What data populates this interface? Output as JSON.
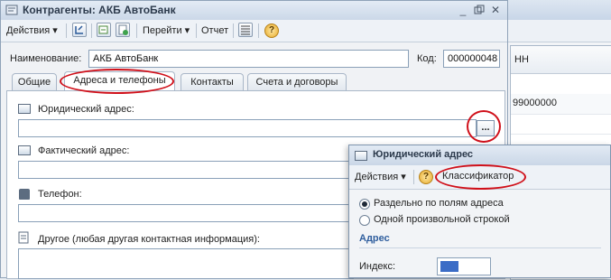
{
  "main": {
    "title": "Контрагенты: АКБ АвтоБанк",
    "toolbar": {
      "actions_label": "Действия",
      "go_label": "Перейти",
      "report_label": "Отчет",
      "help": "?"
    },
    "name_label": "Наименование:",
    "name_value": "АКБ АвтоБанк",
    "code_label": "Код:",
    "code_value": "000000048",
    "tabs": [
      {
        "label": "Общие"
      },
      {
        "label": "Адреса и телефоны"
      },
      {
        "label": "Контакты"
      },
      {
        "label": "Счета и договоры"
      }
    ],
    "fields": {
      "legal_address_label": "Юридический адрес:",
      "actual_address_label": "Фактический адрес:",
      "phone_label": "Телефон:",
      "other_label": "Другое (любая другая контактная информация):",
      "ellipsis": "..."
    }
  },
  "background_window": {
    "column_header": "НН",
    "cell_value": "99000000"
  },
  "popup": {
    "title": "Юридический адрес",
    "actions_label": "Действия",
    "help": "?",
    "classifier_label": "Классификатор",
    "radio_fields": "Раздельно по полям адреса",
    "radio_free": "Одной произвольной строкой",
    "section_title": "Адрес",
    "index_label": "Индекс:"
  },
  "colors": {
    "highlight_oval": "#d0101a",
    "section_heading": "#2f5e9e"
  }
}
